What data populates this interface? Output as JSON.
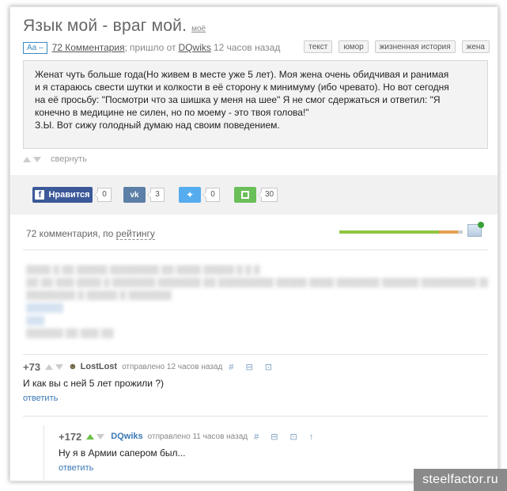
{
  "post": {
    "title": "Язык мой - враг мой.",
    "title_tag": "моё",
    "aa_label": "Aa –",
    "comments_link": "72 Комментария",
    "sep": ";",
    "from_text": "пришло от",
    "author": "DQwiks",
    "time": "12 часов назад",
    "tags": [
      "текст",
      "юмор",
      "жизненная история",
      "жена"
    ],
    "body": [
      "Женат чуть больше года(Но живем в месте уже 5 лет). Моя жена очень обидчивая и ранимая",
      "и я стараюсь свести шутки и колкости в её сторону к минимуму (ибо чревато). Но вот сегодня",
      "на её просьбу: \"Посмотри что за шишка у меня на шее\" Я не смог сдержаться и ответил: \"Я",
      "конечно в медицине не силен, но по моему - это твоя голова!\"",
      "З.Ы. Вот сижу голодный думаю над своим поведением."
    ],
    "collapse_label": "свернуть"
  },
  "share": {
    "facebook_label": "Нравится",
    "facebook_count": "0",
    "vk_count": "3",
    "twitter_count": "0",
    "save_count": "30"
  },
  "comments_header": {
    "prefix": "72 комментария, по",
    "sort_link": "рейтингу"
  },
  "comments": [
    {
      "score": "+73",
      "author": "LostLost",
      "sent": "отправлено 12 часов назад",
      "icons": "# ⊟ ⊡",
      "body": "И как вы с ней 5 лет прожили ?)",
      "reply": "ответить"
    },
    {
      "score": "+172",
      "author": "DQwiks",
      "sent": "отправлено 11 часов назад",
      "icons": "# ⊟ ⊡ ↑",
      "body": "Ну я в Армии сапером был...",
      "reply": "ответить"
    }
  ],
  "watermark": "steelfactor.ru",
  "colors": {
    "link_blue": "#3a78b5",
    "facebook": "#3b5998",
    "vk": "#5b7fa6",
    "twitter": "#55acee",
    "save": "#6bbf59",
    "rating_positive": "#8dc63f",
    "rating_negative": "#e6a050"
  }
}
